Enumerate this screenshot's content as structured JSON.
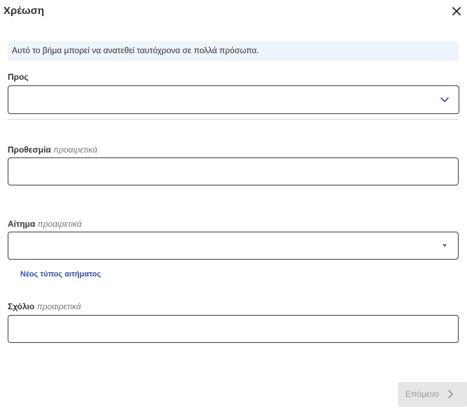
{
  "dialog": {
    "title": "Χρέωση",
    "info": "Αυτό το βήμα μπορεί να ανατεθεί ταυτόχρονα σε πολλά πρόσωπα."
  },
  "to_field": {
    "label": "Προς",
    "value": ""
  },
  "deadline_field": {
    "label": "Προθεσμία",
    "optional": "προαιρετικά",
    "value": ""
  },
  "request_field": {
    "label": "Αίτημα",
    "optional": "προαιρετικά",
    "value": ""
  },
  "new_request_type_link": "Νέος τύπος αιτήματος",
  "comment_field": {
    "label": "Σχόλιο",
    "optional": "προαιρετικά",
    "value": ""
  },
  "footer": {
    "next_label": "Επόμενο"
  },
  "icons": {
    "close": "close-icon",
    "to_dropdown": "chevron-down-icon",
    "request_dropdown": "caret-down-icon",
    "next": "chevron-right-icon"
  },
  "colors": {
    "info_bg": "#eef4fb",
    "link": "#2f4fa8",
    "chevron_blue": "#2d4e9c",
    "disabled_button_bg": "#e6e6e6",
    "disabled_button_text": "#9a9a9a"
  }
}
